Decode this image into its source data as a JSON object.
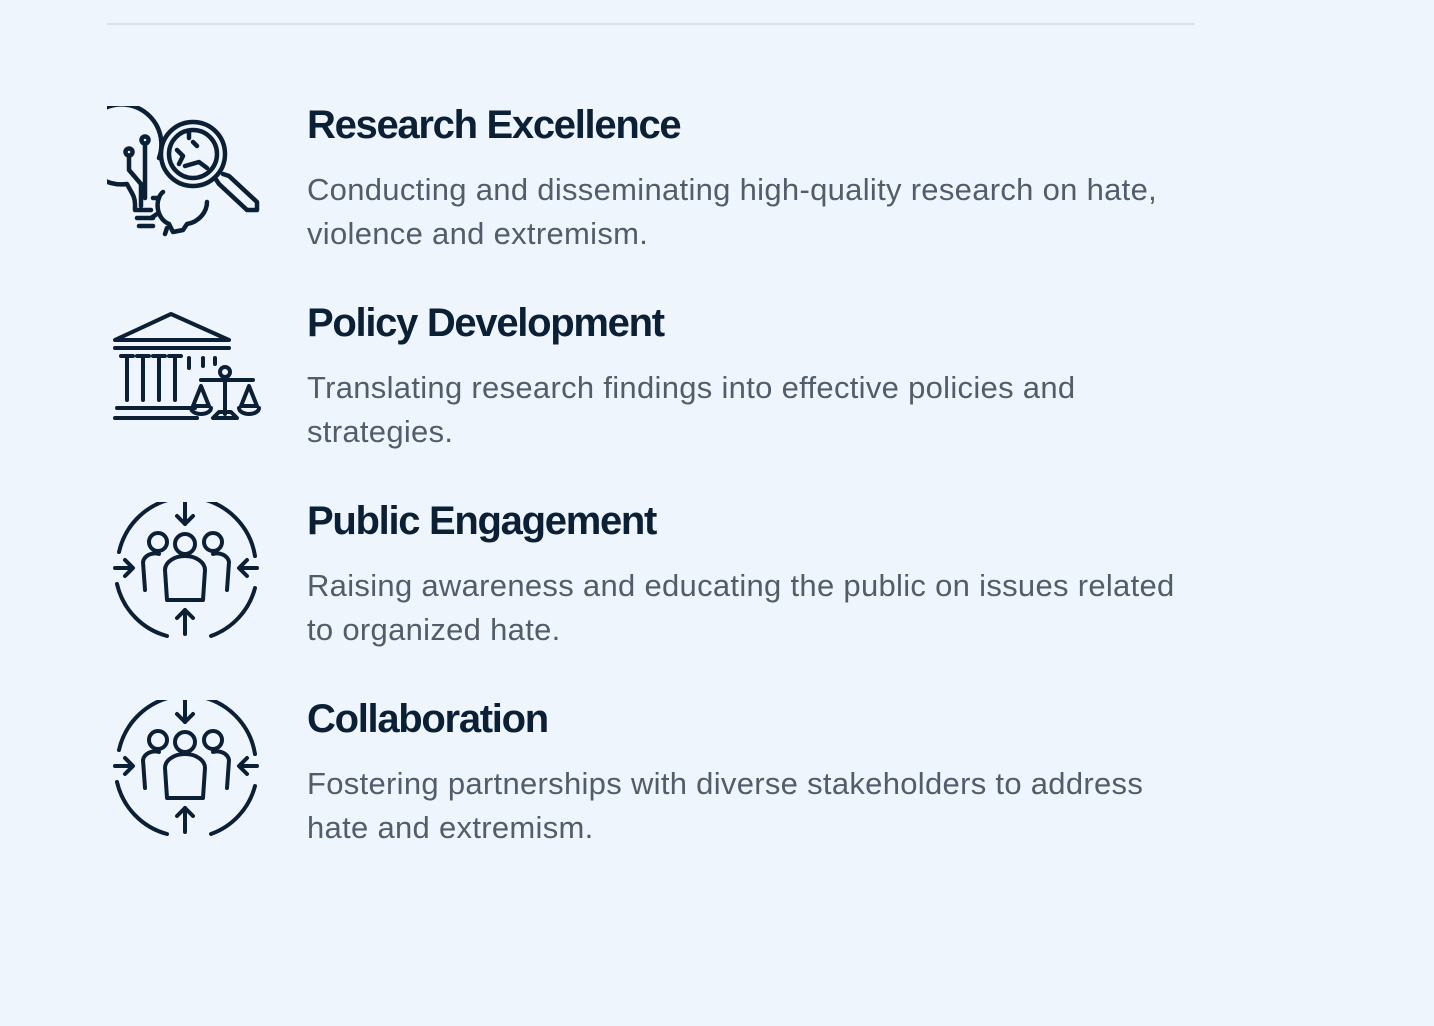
{
  "features": [
    {
      "icon": "research-magnifier-lightbulb-icon",
      "title": "Research Excellence",
      "description": "Conducting and disseminating high-quality research on hate, violence and extremism."
    },
    {
      "icon": "government-building-scales-icon",
      "title": "Policy Development",
      "description": "Translating research findings into effective policies and strategies."
    },
    {
      "icon": "people-cycle-arrows-icon",
      "title": "Public Engagement",
      "description": "Raising awareness and educating the public on issues related to organized hate."
    },
    {
      "icon": "people-cycle-arrows-icon",
      "title": "Collaboration",
      "description": "Fostering partnerships with diverse stakeholders to address hate and extremism."
    }
  ],
  "colors": {
    "background": "#eff5fd",
    "heading": "#0b1f35",
    "body_text": "#525d6a",
    "icon_stroke": "#0b1f35",
    "divider": "#dbe1ea"
  }
}
